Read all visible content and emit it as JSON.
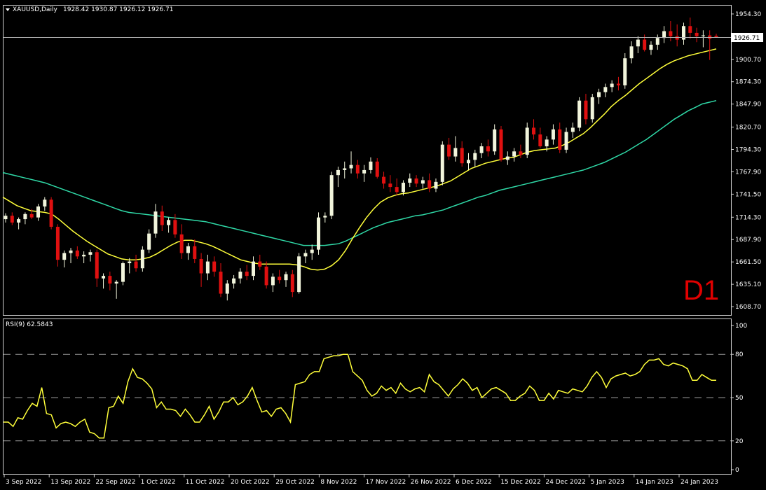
{
  "chart_title": "XAUUSD,Daily",
  "ohlc_header": "1928.42 1930.87 1926.12 1926.71",
  "current_price_label": "1926.71",
  "timeframe_label": "D1",
  "rsi_label": "RSI(9) 62.5843",
  "colors": {
    "background": "#000000",
    "bull": "#f2f5dc",
    "bear": "#e01010",
    "ma_fast": "#ffff3a",
    "ma_slow": "#2fd9a7",
    "rsi": "#ffff3a",
    "grid_frame": "#cfcfcf",
    "text": "#ffffff",
    "timeframe": "#e00000"
  },
  "price_axis_ticks": [
    "1954.30",
    "1927.50",
    "1900.70",
    "1874.30",
    "1847.90",
    "1820.70",
    "1794.30",
    "1767.90",
    "1741.50",
    "1714.30",
    "1687.90",
    "1661.50",
    "1635.10",
    "1608.70"
  ],
  "rsi_axis_ticks": [
    "100",
    "80",
    "50",
    "20",
    "0"
  ],
  "time_axis_ticks": [
    "3 Sep 2022",
    "13 Sep 2022",
    "22 Sep 2022",
    "1 Oct 2022",
    "11 Oct 2022",
    "20 Oct 2022",
    "29 Oct 2022",
    "8 Nov 2022",
    "17 Nov 2022",
    "26 Nov 2022",
    "6 Dec 2022",
    "15 Dec 2022",
    "24 Dec 2022",
    "5 Jan 2023",
    "14 Jan 2023",
    "24 Jan 2023"
  ],
  "chart_data": [
    {
      "type": "candlestick",
      "title": "XAUUSD,Daily",
      "ylim": [
        1598,
        1965
      ],
      "rsi_levels_dashed": [
        80,
        50,
        20
      ],
      "series": [
        {
          "name": "XAUUSD",
          "ohlc": [
            [
              1712,
              1719,
              1708,
              1716
            ],
            [
              1716,
              1720,
              1705,
              1708
            ],
            [
              1708,
              1714,
              1700,
              1712
            ],
            [
              1712,
              1720,
              1706,
              1718
            ],
            [
              1718,
              1724,
              1712,
              1714
            ],
            [
              1714,
              1730,
              1710,
              1727
            ],
            [
              1727,
              1738,
              1722,
              1735
            ],
            [
              1735,
              1738,
              1700,
              1703
            ],
            [
              1703,
              1706,
              1656,
              1664
            ],
            [
              1664,
              1675,
              1655,
              1672
            ],
            [
              1672,
              1678,
              1660,
              1675
            ],
            [
              1675,
              1680,
              1665,
              1668
            ],
            [
              1668,
              1674,
              1660,
              1670
            ],
            [
              1670,
              1676,
              1662,
              1673
            ],
            [
              1673,
              1676,
              1632,
              1642
            ],
            [
              1642,
              1648,
              1630,
              1645
            ],
            [
              1645,
              1650,
              1628,
              1636
            ],
            [
              1636,
              1640,
              1618,
              1638
            ],
            [
              1638,
              1662,
              1634,
              1660
            ],
            [
              1660,
              1666,
              1648,
              1662
            ],
            [
              1662,
              1670,
              1650,
              1654
            ],
            [
              1654,
              1680,
              1650,
              1676
            ],
            [
              1676,
              1700,
              1672,
              1695
            ],
            [
              1695,
              1730,
              1690,
              1721
            ],
            [
              1721,
              1728,
              1698,
              1705
            ],
            [
              1705,
              1714,
              1696,
              1711
            ],
            [
              1711,
              1718,
              1690,
              1694
            ],
            [
              1694,
              1706,
              1665,
              1672
            ],
            [
              1672,
              1684,
              1664,
              1680
            ],
            [
              1680,
              1688,
              1660,
              1665
            ],
            [
              1665,
              1672,
              1632,
              1648
            ],
            [
              1648,
              1670,
              1640,
              1662
            ],
            [
              1662,
              1668,
              1644,
              1650
            ],
            [
              1650,
              1660,
              1620,
              1624
            ],
            [
              1624,
              1640,
              1616,
              1636
            ],
            [
              1636,
              1646,
              1630,
              1642
            ],
            [
              1642,
              1654,
              1636,
              1650
            ],
            [
              1650,
              1658,
              1640,
              1645
            ],
            [
              1645,
              1668,
              1640,
              1662
            ],
            [
              1662,
              1670,
              1652,
              1656
            ],
            [
              1656,
              1662,
              1630,
              1634
            ],
            [
              1634,
              1648,
              1626,
              1644
            ],
            [
              1644,
              1652,
              1636,
              1640
            ],
            [
              1640,
              1650,
              1632,
              1647
            ],
            [
              1647,
              1652,
              1620,
              1626
            ],
            [
              1626,
              1672,
              1624,
              1668
            ],
            [
              1668,
              1676,
              1660,
              1672
            ],
            [
              1672,
              1682,
              1664,
              1676
            ],
            [
              1676,
              1720,
              1670,
              1714
            ],
            [
              1714,
              1720,
              1708,
              1716
            ],
            [
              1716,
              1768,
              1712,
              1764
            ],
            [
              1764,
              1774,
              1750,
              1770
            ],
            [
              1770,
              1780,
              1760,
              1772
            ],
            [
              1772,
              1792,
              1766,
              1776
            ],
            [
              1776,
              1782,
              1760,
              1766
            ],
            [
              1766,
              1776,
              1756,
              1770
            ],
            [
              1770,
              1785,
              1766,
              1780
            ],
            [
              1780,
              1784,
              1760,
              1762
            ],
            [
              1762,
              1768,
              1748,
              1754
            ],
            [
              1754,
              1764,
              1744,
              1750
            ],
            [
              1750,
              1760,
              1740,
              1744
            ],
            [
              1744,
              1758,
              1740,
              1755
            ],
            [
              1755,
              1766,
              1750,
              1760
            ],
            [
              1760,
              1764,
              1750,
              1754
            ],
            [
              1754,
              1762,
              1748,
              1758
            ],
            [
              1758,
              1766,
              1744,
              1748
            ],
            [
              1748,
              1760,
              1744,
              1756
            ],
            [
              1756,
              1804,
              1752,
              1800
            ],
            [
              1800,
              1808,
              1782,
              1786
            ],
            [
              1786,
              1810,
              1780,
              1796
            ],
            [
              1796,
              1804,
              1774,
              1778
            ],
            [
              1778,
              1790,
              1770,
              1782
            ],
            [
              1782,
              1794,
              1774,
              1790
            ],
            [
              1790,
              1802,
              1784,
              1798
            ],
            [
              1798,
              1806,
              1786,
              1792
            ],
            [
              1792,
              1824,
              1788,
              1818
            ],
            [
              1818,
              1822,
              1780,
              1782
            ],
            [
              1782,
              1792,
              1776,
              1786
            ],
            [
              1786,
              1796,
              1780,
              1792
            ],
            [
              1792,
              1800,
              1784,
              1788
            ],
            [
              1788,
              1826,
              1784,
              1820
            ],
            [
              1820,
              1830,
              1806,
              1812
            ],
            [
              1812,
              1820,
              1796,
              1798
            ],
            [
              1798,
              1810,
              1792,
              1806
            ],
            [
              1806,
              1824,
              1800,
              1818
            ],
            [
              1818,
              1826,
              1790,
              1794
            ],
            [
              1794,
              1820,
              1790,
              1815
            ],
            [
              1815,
              1826,
              1808,
              1820
            ],
            [
              1820,
              1856,
              1816,
              1852
            ],
            [
              1852,
              1860,
              1824,
              1830
            ],
            [
              1830,
              1860,
              1826,
              1856
            ],
            [
              1856,
              1866,
              1848,
              1862
            ],
            [
              1862,
              1872,
              1856,
              1868
            ],
            [
              1868,
              1876,
              1862,
              1872
            ],
            [
              1872,
              1880,
              1864,
              1870
            ],
            [
              1870,
              1908,
              1866,
              1902
            ],
            [
              1902,
              1922,
              1896,
              1916
            ],
            [
              1916,
              1928,
              1908,
              1924
            ],
            [
              1924,
              1930,
              1910,
              1912
            ],
            [
              1912,
              1922,
              1906,
              1918
            ],
            [
              1918,
              1930,
              1912,
              1926
            ],
            [
              1926,
              1940,
              1920,
              1934
            ],
            [
              1934,
              1946,
              1922,
              1928
            ],
            [
              1928,
              1942,
              1916,
              1924
            ],
            [
              1924,
              1944,
              1918,
              1940
            ],
            [
              1940,
              1950,
              1925,
              1932
            ],
            [
              1932,
              1938,
              1921,
              1928
            ],
            [
              1928,
              1935,
              1915,
              1929
            ],
            [
              1929,
              1935,
              1900,
              1925
            ],
            [
              1928.42,
              1930.87,
              1926.12,
              1926.71
            ]
          ]
        },
        {
          "name": "MA fast",
          "values": [
            1738,
            1733,
            1728,
            1725,
            1722,
            1721,
            1720,
            1718,
            1712,
            1705,
            1698,
            1692,
            1686,
            1681,
            1676,
            1671,
            1668,
            1665,
            1664,
            1664,
            1665,
            1667,
            1671,
            1676,
            1681,
            1685,
            1687,
            1687,
            1685,
            1683,
            1680,
            1676,
            1672,
            1668,
            1664,
            1662,
            1660,
            1659,
            1659,
            1659,
            1659,
            1659,
            1658,
            1656,
            1653,
            1652,
            1653,
            1657,
            1664,
            1675,
            1689,
            1702,
            1714,
            1724,
            1732,
            1737,
            1740,
            1742,
            1743,
            1745,
            1747,
            1749,
            1751,
            1754,
            1757,
            1762,
            1767,
            1772,
            1775,
            1778,
            1780,
            1782,
            1784,
            1785,
            1788,
            1791,
            1793,
            1794,
            1795,
            1796,
            1799,
            1803,
            1808,
            1813,
            1820,
            1828,
            1836,
            1845,
            1852,
            1858,
            1865,
            1872,
            1878,
            1884,
            1890,
            1895,
            1899,
            1902,
            1905,
            1907,
            1909,
            1911,
            1913
          ]
        },
        {
          "name": "MA slow",
          "values": [
            1767,
            1765,
            1763,
            1761,
            1759,
            1757,
            1755,
            1752,
            1749,
            1746,
            1743,
            1740,
            1737,
            1734,
            1731,
            1728,
            1725,
            1722,
            1720,
            1719,
            1718,
            1717,
            1716,
            1715,
            1714,
            1713,
            1712,
            1711,
            1710,
            1709,
            1707,
            1705,
            1703,
            1701,
            1699,
            1697,
            1695,
            1693,
            1691,
            1689,
            1687,
            1685,
            1683,
            1681,
            1681,
            1681,
            1681,
            1682,
            1683,
            1686,
            1690,
            1694,
            1698,
            1702,
            1705,
            1708,
            1710,
            1712,
            1714,
            1716,
            1717,
            1719,
            1721,
            1723,
            1726,
            1729,
            1732,
            1735,
            1738,
            1740,
            1743,
            1746,
            1748,
            1750,
            1752,
            1754,
            1756,
            1758,
            1760,
            1762,
            1764,
            1766,
            1768,
            1770,
            1773,
            1776,
            1779,
            1783,
            1787,
            1791,
            1796,
            1801,
            1806,
            1812,
            1818,
            1824,
            1830,
            1835,
            1840,
            1844,
            1848,
            1850,
            1852
          ]
        },
        {
          "name": "RSI(9)",
          "values": [
            33,
            33,
            30,
            36,
            35,
            41,
            46,
            44,
            57,
            39,
            38,
            29,
            32,
            33,
            32,
            30,
            33,
            35,
            26,
            25,
            22,
            22,
            43,
            44,
            51,
            46,
            61,
            70,
            64,
            63,
            60,
            56,
            43,
            47,
            42,
            42,
            41,
            37,
            42,
            38,
            33,
            33,
            38,
            44,
            35,
            40,
            47,
            47,
            50,
            45,
            47,
            51,
            57,
            48,
            40,
            41,
            37,
            42,
            43,
            39,
            33,
            59,
            60,
            61,
            66,
            68,
            68,
            77,
            78,
            79,
            79,
            80,
            80,
            68,
            65,
            62,
            55,
            51,
            53,
            58,
            55,
            57,
            53,
            60,
            56,
            54,
            56,
            57,
            54,
            66,
            61,
            59,
            55,
            51,
            56,
            59,
            63,
            60,
            55,
            57,
            50,
            53,
            56,
            57,
            55,
            53,
            48,
            48,
            51,
            53,
            58,
            55,
            48,
            48,
            53,
            49,
            55,
            54,
            53,
            56,
            55,
            54,
            58,
            64,
            68,
            64,
            57,
            63,
            65,
            66,
            67,
            65,
            66,
            68,
            73,
            76,
            76,
            77,
            73,
            72,
            74,
            73,
            72,
            70,
            62,
            62,
            66,
            64,
            62,
            62
          ]
        }
      ]
    }
  ]
}
